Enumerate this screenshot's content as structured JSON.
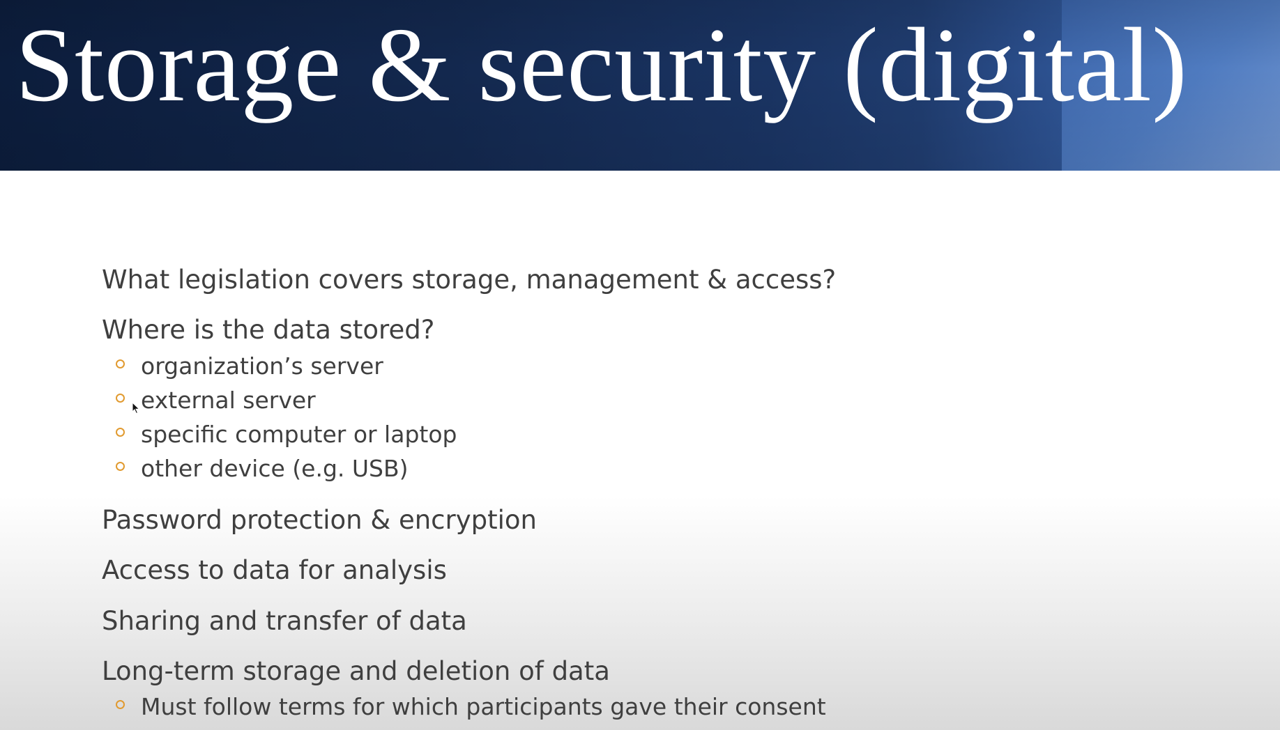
{
  "slide": {
    "title": "Storage & security (digital)",
    "colors": {
      "title_bar": "#13284e",
      "title_accent": "#4f7bc0",
      "title_text": "#ffffff",
      "body_text": "#3f3f3f",
      "sub_bullet_marker": "#e19a2f"
    },
    "bullets": [
      {
        "text": "What legislation covers storage, management & access?",
        "sub": []
      },
      {
        "text": "Where is the data stored?",
        "sub": [
          "organization’s server",
          "external server",
          "specific computer or laptop",
          "other device (e.g. USB)"
        ]
      },
      {
        "text": "Password protection & encryption",
        "sub": []
      },
      {
        "text": "Access to data for analysis",
        "sub": []
      },
      {
        "text": "Sharing and transfer of data",
        "sub": []
      },
      {
        "text": "Long-term storage and deletion of data",
        "sub": [
          "Must follow terms for which participants gave their consent"
        ]
      }
    ],
    "cursor_icon": "mouse-pointer-icon",
    "sub_bullet_icon": "hollow-circle-bullet-icon"
  }
}
